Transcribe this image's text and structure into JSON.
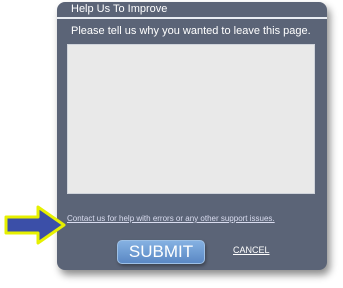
{
  "dialog": {
    "title": "Help Us To Improve",
    "prompt": "Please tell us why you wanted to leave this page.",
    "feedback": {
      "value": "",
      "placeholder": ""
    },
    "support_link": "Contact us for help with errors or any other support issues.",
    "submit_label": "SUBMIT",
    "cancel_label": "CANCEL"
  },
  "annotation": {
    "icon": "arrow-right-icon",
    "fill_color": "#3b4fa8",
    "outline_color": "#e6f000"
  },
  "colors": {
    "dialog_background": "#5b6477",
    "submit_button": "#6f9ed6"
  }
}
